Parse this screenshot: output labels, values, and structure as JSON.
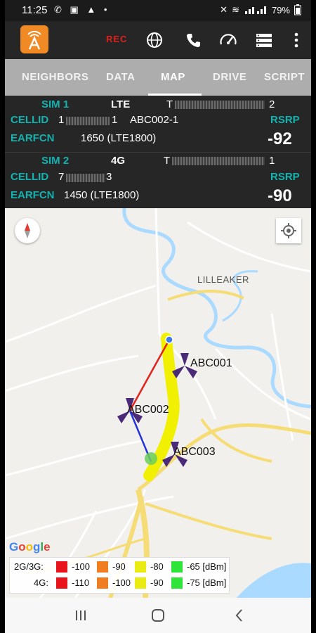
{
  "status_bar": {
    "time": "11:25",
    "battery": "79%"
  },
  "app_bar": {
    "rec_label": "REC"
  },
  "tabs": [
    {
      "label": "NEIGHBORS"
    },
    {
      "label": "DATA"
    },
    {
      "label": "MAP"
    },
    {
      "label": "DRIVE"
    },
    {
      "label": "SCRIPT"
    }
  ],
  "sims": [
    {
      "name": "SIM 1",
      "tech": "LTE",
      "operator_prefix": "T",
      "operator_suffix": "2",
      "cellid_label": "CELLID",
      "cellid_prefix": "1",
      "cellid_suffix": "1",
      "cell_name": "ABC002-1",
      "earfcn_label": "EARFCN",
      "earfcn": "1650 (LTE1800)",
      "rsrp_label": "RSRP",
      "rsrp": "-92"
    },
    {
      "name": "SIM 2",
      "tech": "4G",
      "operator_prefix": "T",
      "operator_suffix": "1",
      "cellid_label": "CELLID",
      "cellid_prefix": "7",
      "cellid_suffix": "3",
      "cell_name": "",
      "earfcn_label": "EARFCN",
      "earfcn": "1450 (LTE1800)",
      "rsrp_label": "RSRP",
      "rsrp": "-90"
    }
  ],
  "map": {
    "place_labels": [
      "LILLEAKER"
    ],
    "cells": [
      "ABC001",
      "ABC002",
      "ABC003"
    ],
    "google_label": [
      "G",
      "o",
      "o",
      "g",
      "l",
      "e"
    ],
    "google_colors": [
      "#4285f4",
      "#ea4335",
      "#fbbc05",
      "#4285f4",
      "#34a853",
      "#ea4335"
    ]
  },
  "legend": {
    "rows": [
      {
        "label": "2G/3G:",
        "values": [
          "-100",
          "-90",
          "-80",
          "-65 [dBm]"
        ]
      },
      {
        "label": "4G:",
        "values": [
          "-110",
          "-100",
          "-90",
          "-75 [dBm]"
        ]
      }
    ],
    "colors": [
      "#e8131b",
      "#f07d1f",
      "#e9eb12",
      "#2ee43a"
    ]
  },
  "colors": {
    "accent": "#13b3b0",
    "rec": "#e0211b",
    "logo": "#f08a24"
  }
}
